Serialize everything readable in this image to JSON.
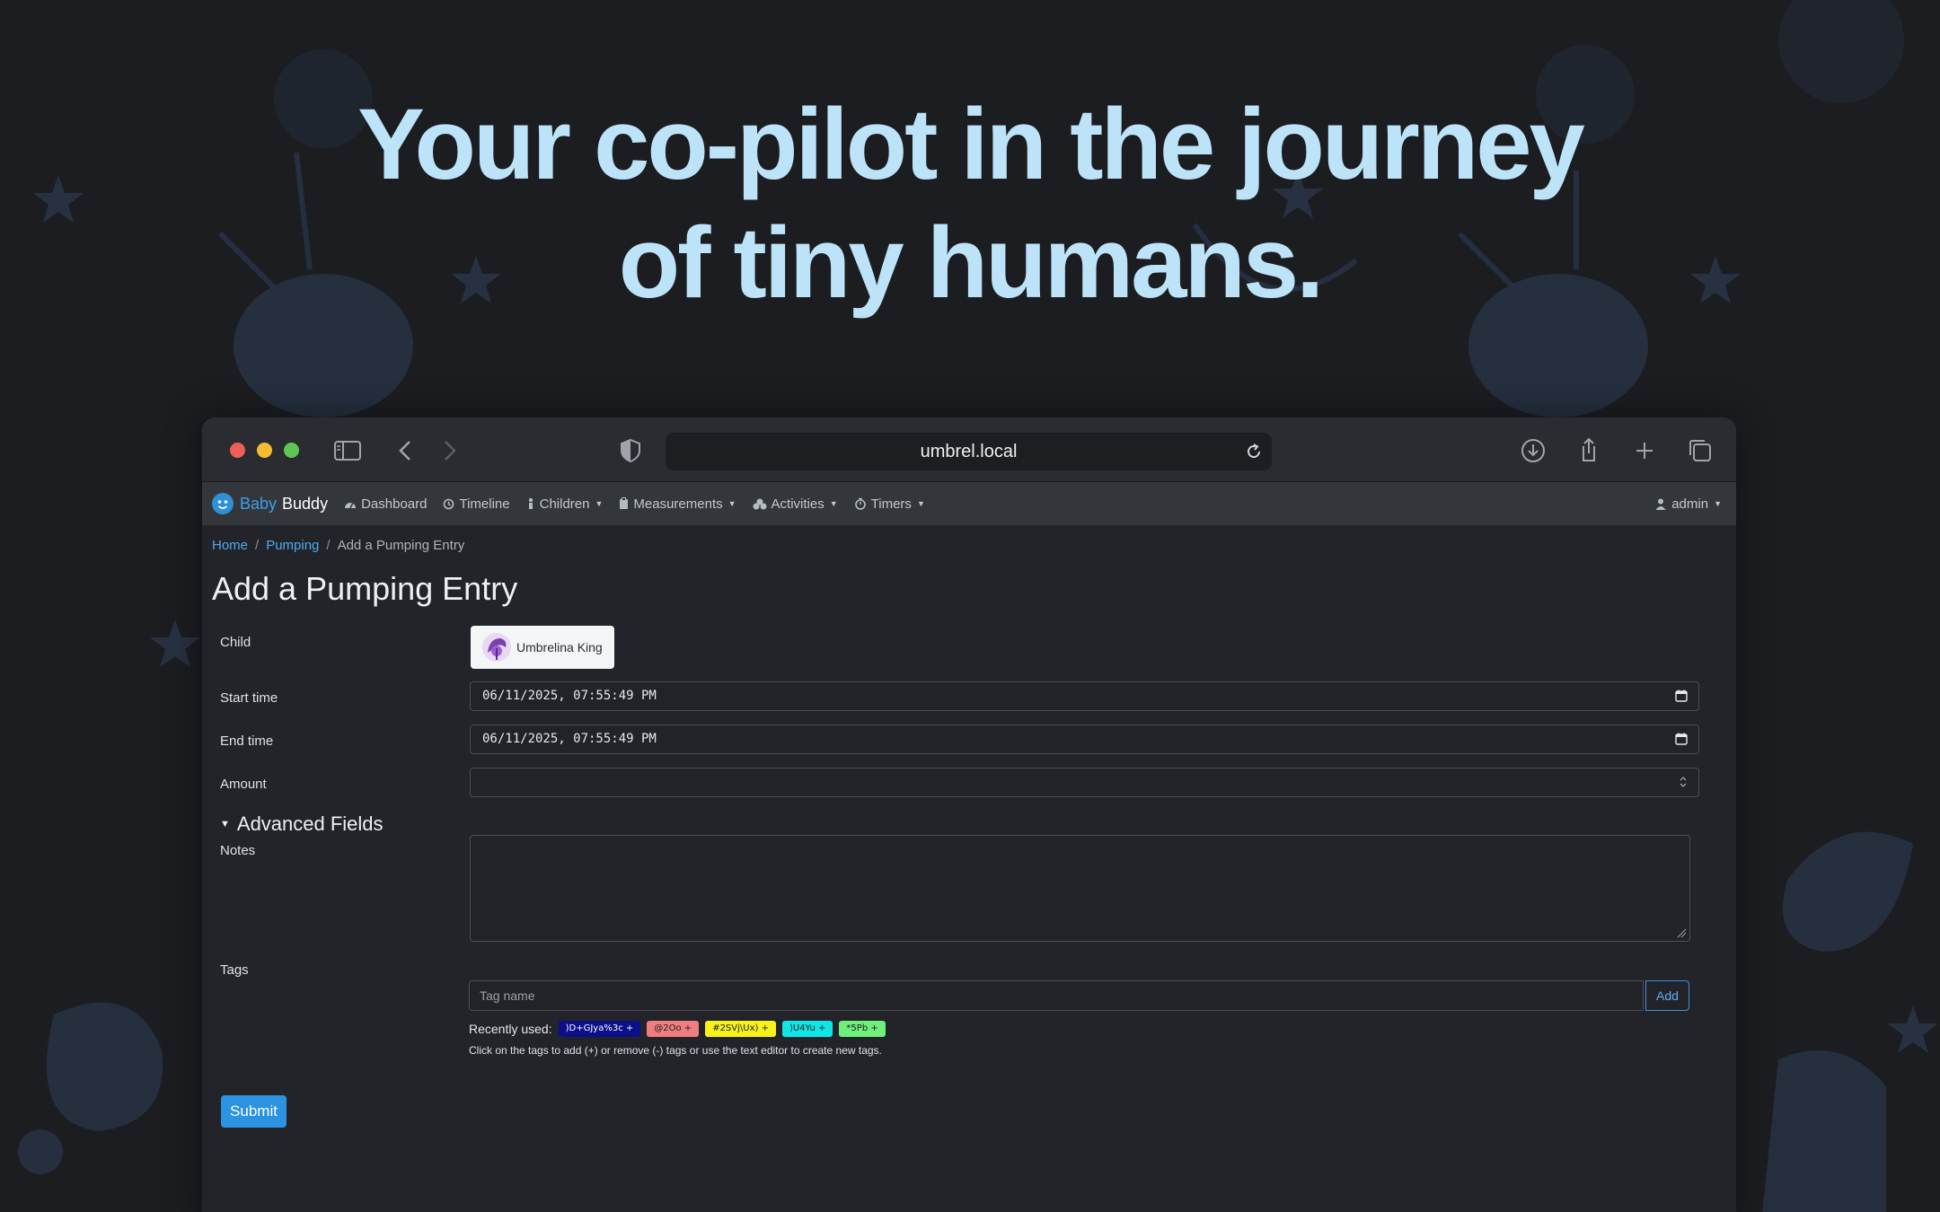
{
  "hero": {
    "line1": "Your co-pilot in the journey",
    "line2": "of tiny humans."
  },
  "browser": {
    "url": "umbrel.local"
  },
  "navbar": {
    "brand_part1": "Baby",
    "brand_part2": "Buddy",
    "items": [
      {
        "label": "Dashboard",
        "icon": "dashboard-icon"
      },
      {
        "label": "Timeline",
        "icon": "history-icon"
      },
      {
        "label": "Children",
        "icon": "child-icon"
      },
      {
        "label": "Measurements",
        "icon": "clipboard-icon"
      },
      {
        "label": "Activities",
        "icon": "activities-icon"
      },
      {
        "label": "Timers",
        "icon": "timer-icon"
      }
    ],
    "user": "admin"
  },
  "breadcrumb": {
    "home": "Home",
    "pumping": "Pumping",
    "current": "Add a Pumping Entry"
  },
  "page_title": "Add a Pumping Entry",
  "form": {
    "child_label": "Child",
    "child_name": "Umbrelina King",
    "start_label": "Start time",
    "start_value": "06/11/2025, 07:55:49 PM",
    "end_label": "End time",
    "end_value": "06/11/2025, 07:55:49 PM",
    "amount_label": "Amount",
    "amount_value": "",
    "advanced_label": "Advanced Fields",
    "notes_label": "Notes",
    "tags_label": "Tags",
    "tag_placeholder": "Tag name",
    "tag_add": "Add",
    "recently_used_label": "Recently used:",
    "recent_tags": [
      {
        "text": ")D+GJya%3c +",
        "bg": "#0c0f8a",
        "fg": "#ffffff"
      },
      {
        "text": "@2Oo +",
        "bg": "#f07e7e",
        "fg": "#1b1d21"
      },
      {
        "text": "#2SVj\\Ux) +",
        "bg": "#f7f21a",
        "fg": "#1b1d21"
      },
      {
        "text": ")U4Yu +",
        "bg": "#10e6e6",
        "fg": "#1b1d21"
      },
      {
        "text": "*5Pb +",
        "bg": "#6ef07a",
        "fg": "#1b1d21"
      }
    ],
    "help_text": "Click on the tags to add (+) or remove (-) tags or use the text editor to create new tags.",
    "submit": "Submit"
  },
  "colors": {
    "hero_text": "#bde3f8",
    "accent": "#2b93e0",
    "page_bg": "#1b1d21"
  }
}
